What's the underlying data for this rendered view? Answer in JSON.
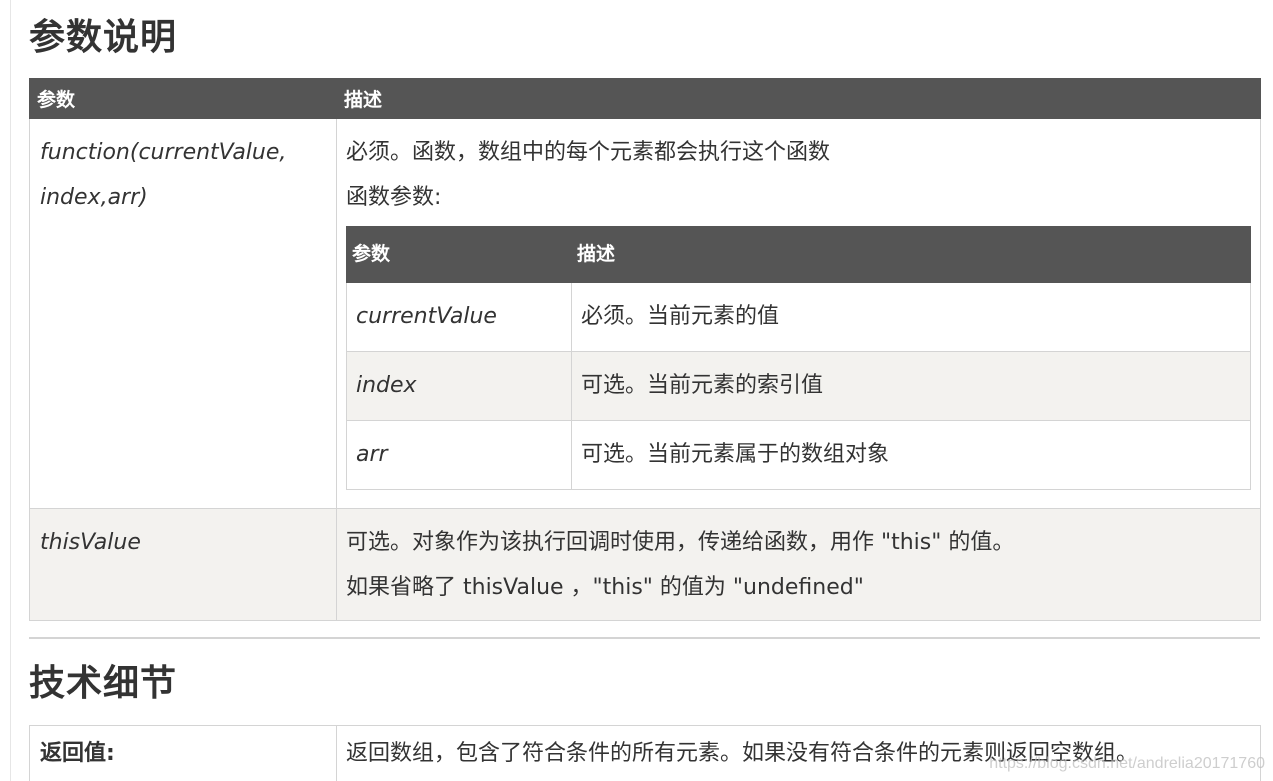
{
  "section_params": {
    "title": "参数说明",
    "headers": [
      "参数",
      "描述"
    ],
    "rows": [
      {
        "param_line1": "function(currentValue,",
        "param_line2": "index,arr)",
        "desc_line1": "必须。函数，数组中的每个元素都会执行这个函数",
        "desc_line2": "函数参数:",
        "nested": {
          "headers": [
            "参数",
            "描述"
          ],
          "rows": [
            {
              "param": "currentValue",
              "desc": "必须。当前元素的值"
            },
            {
              "param": "index",
              "desc": "可选。当前元素的索引值"
            },
            {
              "param": "arr",
              "desc": "可选。当前元素属于的数组对象"
            }
          ]
        }
      },
      {
        "param": "thisValue",
        "desc_line1": "可选。对象作为该执行回调时使用，传递给函数，用作 \"this\" 的值。",
        "desc_line2": "如果省略了 thisValue ，\"this\" 的值为 \"undefined\""
      }
    ]
  },
  "section_tech": {
    "title": "技术细节",
    "rows": [
      {
        "label": "返回值:",
        "value": "返回数组，包含了符合条件的所有元素。如果没有符合条件的元素则返回空数组。"
      }
    ]
  },
  "watermark": "https://blog.csdn.net/andrelia20171760"
}
